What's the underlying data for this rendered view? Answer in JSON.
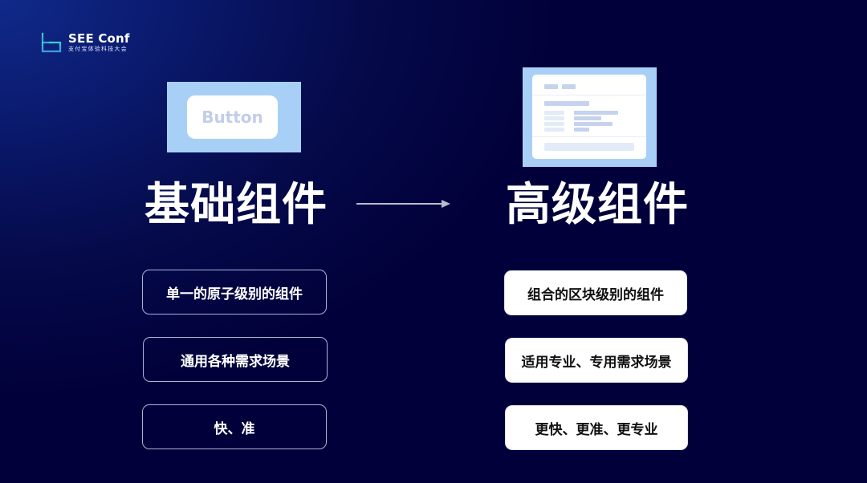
{
  "logo": {
    "title": "SEE Conf",
    "subtitle": "支付宝体验科技大会",
    "mark_color": "#3ec6d6"
  },
  "illustrations": {
    "basic_button_label": "Button",
    "panel_color": "#a8d0f7"
  },
  "left": {
    "heading": "基础组件",
    "items": [
      "单一的原子级别的组件",
      "通用各种需求场景",
      "快、准"
    ]
  },
  "right": {
    "heading": "高级组件",
    "items": [
      "组合的区块级别的组件",
      "适用专业、专用需求场景",
      "更快、更准、更专业"
    ]
  },
  "arrow": {
    "icon": "arrow-right-icon",
    "color": "#b8bccc"
  },
  "colors": {
    "background": "#01003a",
    "background_glow": "#102a8a"
  }
}
